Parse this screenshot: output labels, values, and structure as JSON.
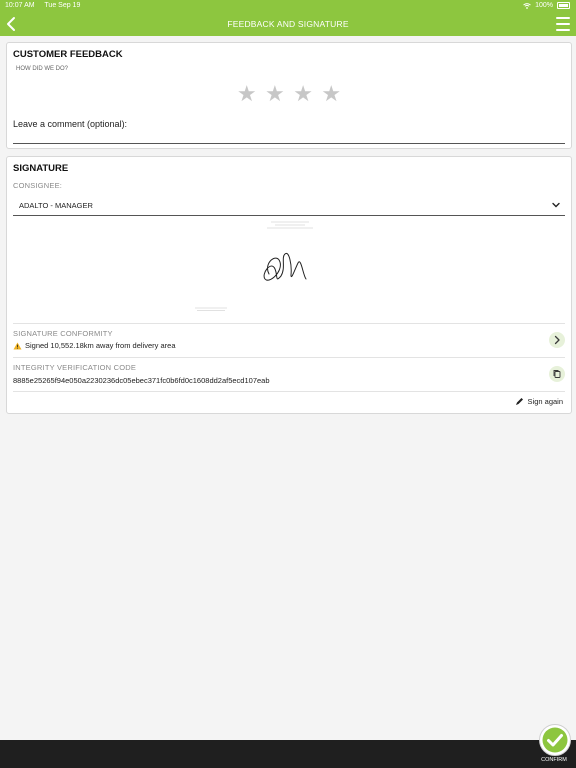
{
  "status_bar": {
    "time": "10:07 AM",
    "date": "Tue Sep 19",
    "battery": "100%"
  },
  "nav": {
    "title": "FEEDBACK AND SIGNATURE"
  },
  "feedback": {
    "title": "CUSTOMER FEEDBACK",
    "subtitle": "HOW DID WE DO?",
    "rating": {
      "value": 0,
      "max": 4
    },
    "comment_label": "Leave a comment (optional):",
    "comment_value": ""
  },
  "signature": {
    "title": "SIGNATURE",
    "consignee_label": "CONSIGNEE:",
    "consignee_value": "ADALTO - MANAGER",
    "conformity_label": "SIGNATURE CONFORMITY",
    "conformity_value": "Signed 10,552.18km away from delivery area",
    "integrity_label": "INTEGRITY VERIFICATION CODE",
    "integrity_value": "8885e25265f94e050a2230236dc05ebec371fc0b6fd0c1608dd2af5ecd107eab",
    "sign_again_label": "Sign again"
  },
  "bottom": {
    "confirm_label": "CONFIRM"
  },
  "colors": {
    "accent": "#8dc63f",
    "dark_bar": "#1f1f1f",
    "warning": "#f0b323"
  },
  "icons": {
    "back": "chevron-left-icon",
    "menu": "hamburger-menu-icon",
    "copy": "copy-icon",
    "edit": "pen-icon",
    "confirm": "checkmark-icon"
  }
}
